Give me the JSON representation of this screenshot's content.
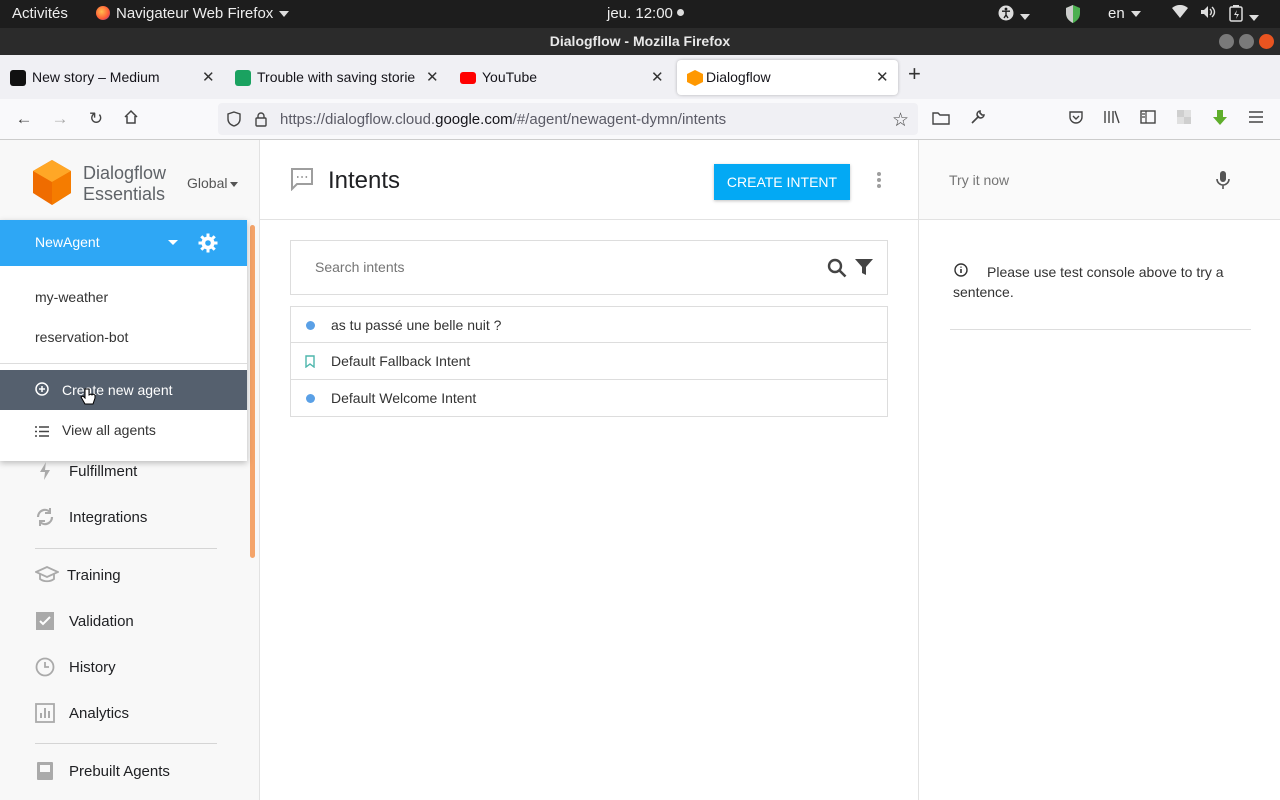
{
  "system_bar": {
    "activities": "Activités",
    "app_menu": "Navigateur Web Firefox",
    "clock": "jeu. 12:00",
    "language": "en"
  },
  "window": {
    "title": "Dialogflow - Mozilla Firefox"
  },
  "tabs": [
    {
      "label": "New story – Medium",
      "favicon_color": "#111111"
    },
    {
      "label": "Trouble with saving storie",
      "favicon_color": "#1aa260"
    },
    {
      "label": "YouTube",
      "favicon_color": "#ff0000"
    },
    {
      "label": "Dialogflow",
      "favicon_color": "#ff9800",
      "active": true
    }
  ],
  "address_bar": {
    "url_prefix": "https://dialogflow.cloud.",
    "url_domain": "google.com",
    "url_suffix": "/#/agent/newagent-dymn/intents"
  },
  "sidebar": {
    "brand_line1": "Dialogflow",
    "brand_line2": "Essentials",
    "region": "Global",
    "agent_menu": {
      "current_agent": "NewAgent",
      "agents": [
        "my-weather",
        "reservation-bot"
      ],
      "create_label": "Create new agent",
      "view_all_label": "View all agents"
    },
    "nav": {
      "fulfillment": "Fulfillment",
      "integrations": "Integrations",
      "training": "Training",
      "validation": "Validation",
      "history": "History",
      "analytics": "Analytics",
      "prebuilt": "Prebuilt Agents"
    }
  },
  "main": {
    "title": "Intents",
    "create_button": "CREATE INTENT",
    "search_placeholder": "Search intents",
    "intents": [
      {
        "name": "as tu passé une belle nuit ?",
        "marker": "dot"
      },
      {
        "name": "Default Fallback Intent",
        "marker": "bookmark"
      },
      {
        "name": "Default Welcome Intent",
        "marker": "dot"
      }
    ]
  },
  "test_console": {
    "placeholder": "Try it now",
    "info_text": "Please use test console above to try a sentence."
  },
  "colors": {
    "accent": "#2ea7f5",
    "button": "#03a9f4",
    "hover_row": "#55606e",
    "scrollbar": "#f4a46a"
  }
}
